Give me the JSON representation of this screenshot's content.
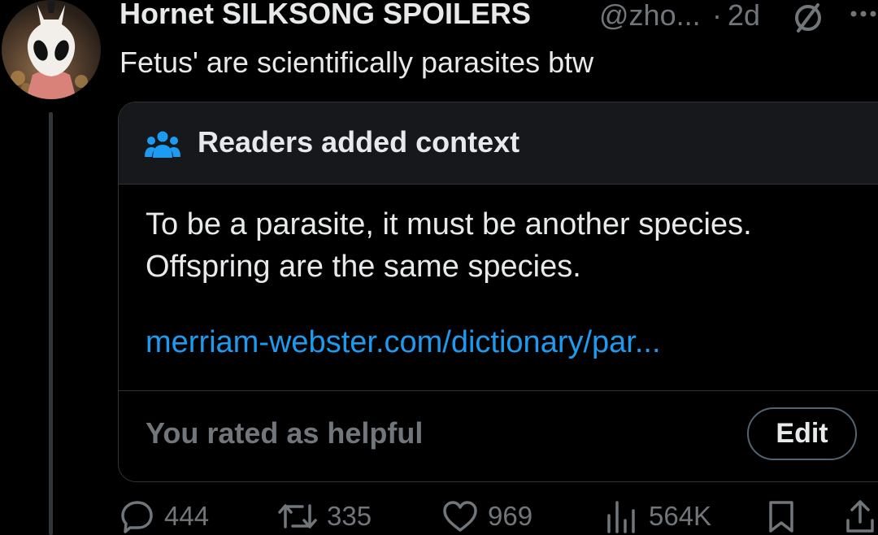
{
  "tweet": {
    "author_name": "Hornet SILKSONG SPOILERS",
    "handle": "@zho...",
    "separator": "·",
    "time": "2d",
    "text": "Fetus' are scientifically parasites btw"
  },
  "community_note": {
    "title": "Readers added context",
    "body_lines": [
      "To be a parasite, it must be another species.",
      "Offspring are the same species."
    ],
    "link": "merriam-webster.com/dictionary/par...",
    "rating_status": "You rated as helpful",
    "edit_label": "Edit"
  },
  "actions": {
    "replies": "444",
    "reposts": "335",
    "likes": "969",
    "views": "564K"
  },
  "colors": {
    "background": "#000000",
    "text": "#e7e9ea",
    "muted": "#71767b",
    "link": "#1d9bf0",
    "note_header_bg": "#16181c",
    "border": "#2f3336"
  },
  "icons": {
    "avatar": "avatar",
    "grok": "grok-icon",
    "more": "more-icon",
    "note": "people-icon",
    "reply": "reply-icon",
    "repost": "repost-icon",
    "like": "heart-icon",
    "views": "views-icon",
    "bookmark": "bookmark-icon",
    "share": "share-icon"
  }
}
